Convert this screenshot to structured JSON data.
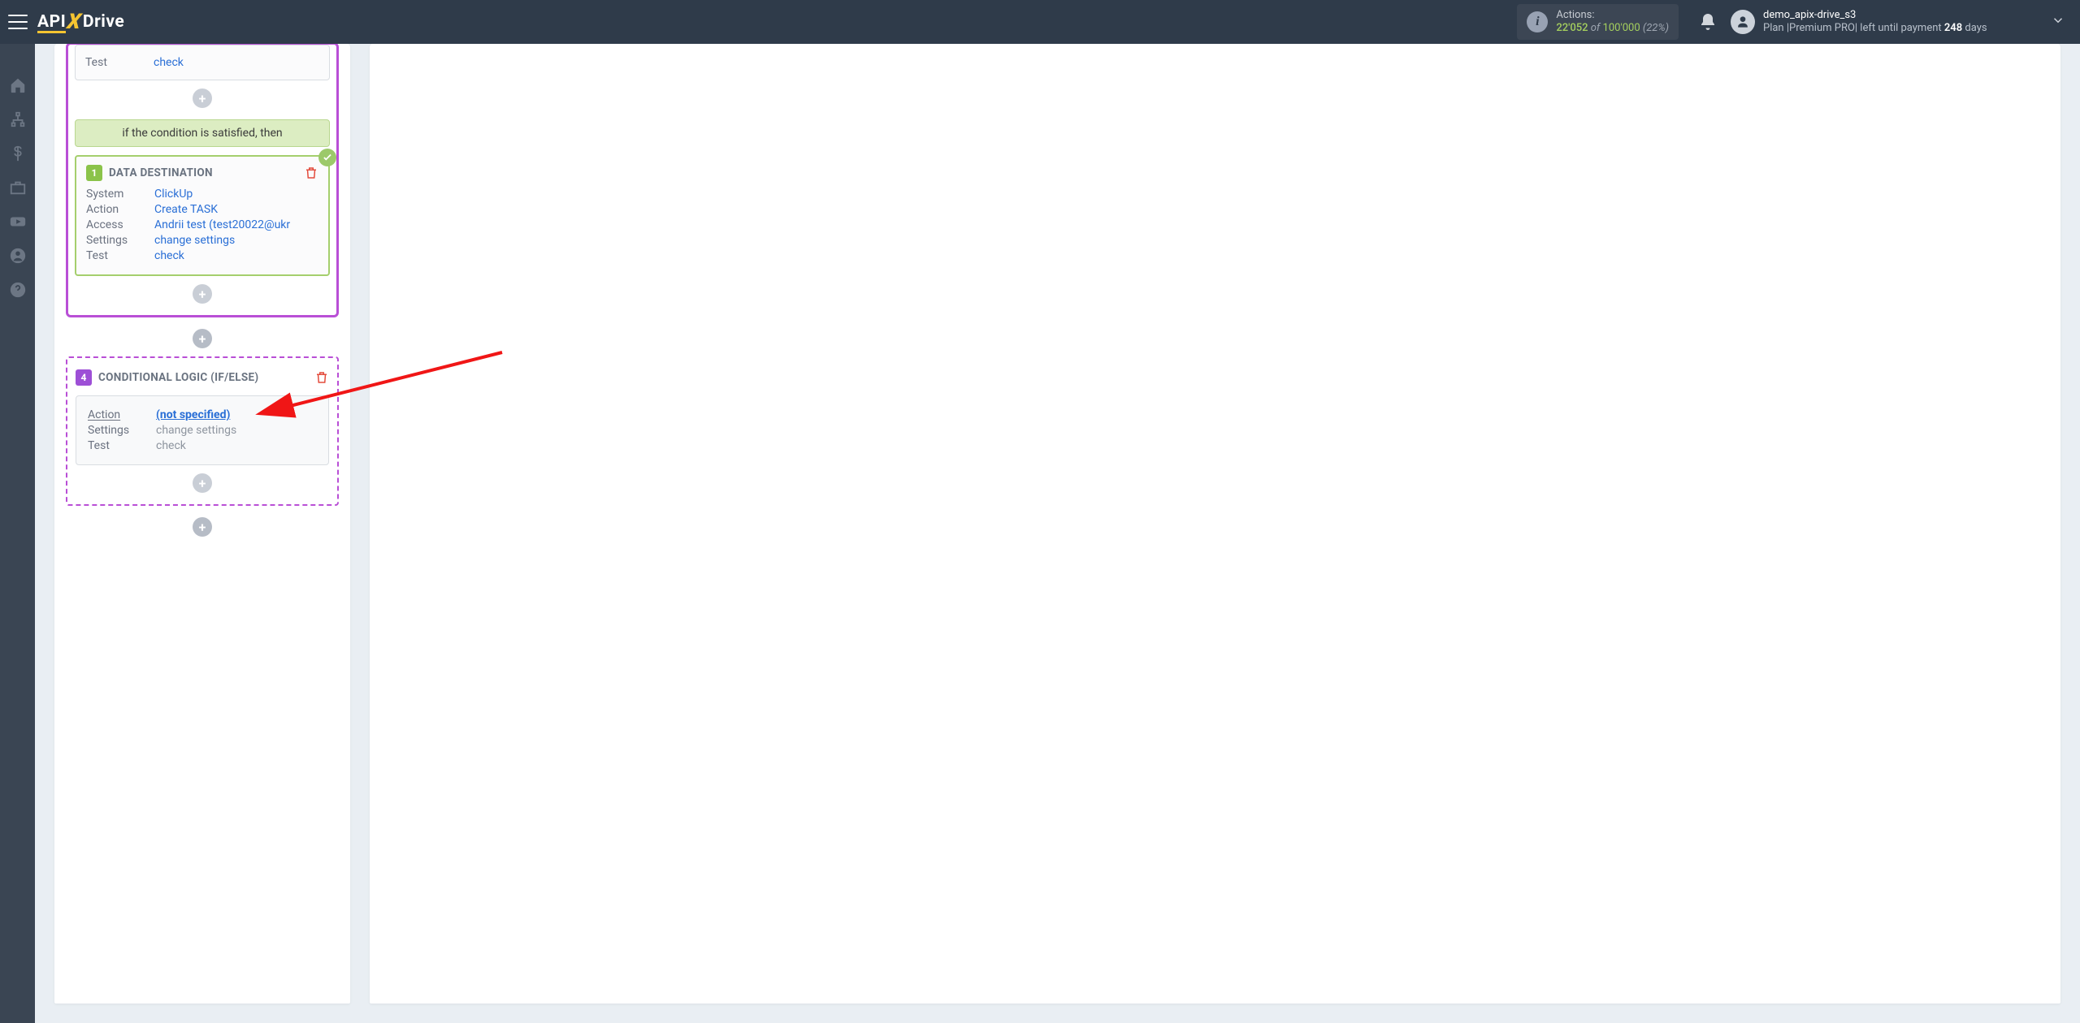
{
  "brand": {
    "left": "API",
    "x": "X",
    "right": "Drive"
  },
  "actions_chip": {
    "label": "Actions:",
    "current": "22'052",
    "of": "of",
    "max": "100'000",
    "percent": "(22%)"
  },
  "user": {
    "name": "demo_apix-drive_s3",
    "plan_prefix": "Plan |Premium PRO| left until payment ",
    "days": "248",
    "plan_suffix": " days"
  },
  "card0": {
    "test_k": "Test",
    "test_v": "check"
  },
  "condition_label": "if the condition is satisfied, then",
  "dest": {
    "num": "1",
    "title": "DATA DESTINATION",
    "rows": {
      "system_k": "System",
      "system_v": "ClickUp",
      "action_k": "Action",
      "action_v": "Create TASK",
      "access_k": "Access",
      "access_v": "Andrii test (test20022@ukr",
      "settings_k": "Settings",
      "settings_v": "change settings",
      "test_k": "Test",
      "test_v": "check"
    }
  },
  "cond": {
    "num": "4",
    "title": "CONDITIONAL LOGIC (IF/ELSE)",
    "rows": {
      "action_k": "Action",
      "action_v": "(not specified)",
      "settings_k": "Settings",
      "settings_v": "change settings",
      "test_k": "Test",
      "test_v": "check"
    }
  },
  "plus": "+"
}
